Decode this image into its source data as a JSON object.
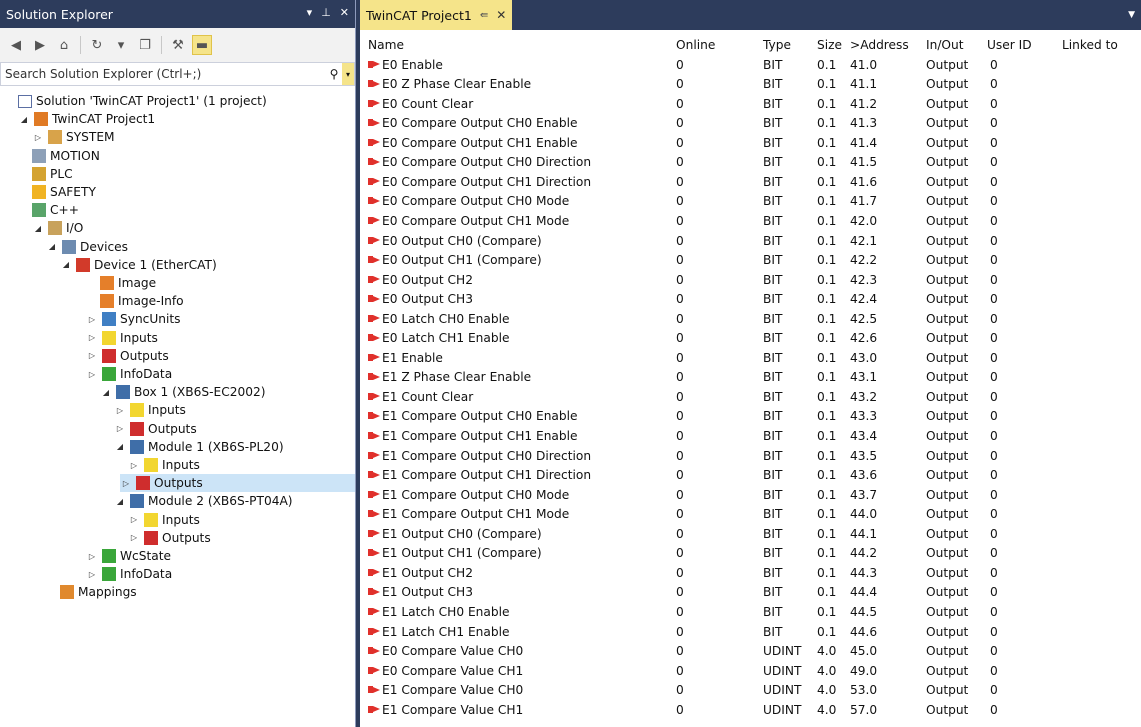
{
  "solution_explorer": {
    "title": "Solution Explorer",
    "title_buttons": [
      "▾",
      "⊥",
      "✕"
    ],
    "search_placeholder": "Search Solution Explorer (Ctrl+;)",
    "tree": [
      {
        "label": "Solution 'TwinCAT Project1' (1 project)",
        "icon": "solution-icon",
        "expand": ""
      },
      {
        "label": "TwinCAT Project1",
        "icon": "twincat-project-icon",
        "expand": "◢"
      },
      {
        "label": "SYSTEM",
        "icon": "system-icon",
        "expand": "▷"
      },
      {
        "label": "MOTION",
        "icon": "motion-icon",
        "expand": ""
      },
      {
        "label": "PLC",
        "icon": "plc-icon",
        "expand": ""
      },
      {
        "label": "SAFETY",
        "icon": "safety-icon",
        "expand": ""
      },
      {
        "label": "C++",
        "icon": "cpp-icon",
        "expand": ""
      },
      {
        "label": "I/O",
        "icon": "io-icon",
        "expand": "◢"
      },
      {
        "label": "Devices",
        "icon": "devices-icon",
        "expand": "◢"
      },
      {
        "label": "Device 1 (EtherCAT)",
        "icon": "ethercat-device-icon",
        "expand": "◢"
      },
      {
        "label": "Image",
        "icon": "image-icon",
        "expand": ""
      },
      {
        "label": "Image-Info",
        "icon": "image-info-icon",
        "expand": ""
      },
      {
        "label": "SyncUnits",
        "icon": "syncunits-icon",
        "expand": "▷"
      },
      {
        "label": "Inputs",
        "icon": "inputs-icon",
        "expand": "▷"
      },
      {
        "label": "Outputs",
        "icon": "outputs-icon",
        "expand": "▷"
      },
      {
        "label": "InfoData",
        "icon": "infodata-icon",
        "expand": "▷"
      },
      {
        "label": "Box 1 (XB6S-EC2002)",
        "icon": "box-icon",
        "expand": "◢"
      },
      {
        "label": "Inputs",
        "icon": "inputs-icon",
        "expand": "▷"
      },
      {
        "label": "Outputs",
        "icon": "outputs-icon",
        "expand": "▷"
      },
      {
        "label": "Module 1 (XB6S-PL20)",
        "icon": "module-icon",
        "expand": "◢"
      },
      {
        "label": "Inputs",
        "icon": "inputs-icon",
        "expand": "▷"
      },
      {
        "label": "Outputs",
        "icon": "outputs-icon",
        "expand": "▷"
      },
      {
        "label": "Module 2 (XB6S-PT04A)",
        "icon": "module-icon",
        "expand": "◢"
      },
      {
        "label": "Inputs",
        "icon": "inputs-icon",
        "expand": "▷"
      },
      {
        "label": "Outputs",
        "icon": "outputs-icon",
        "expand": "▷"
      },
      {
        "label": "WcState",
        "icon": "wcstate-icon",
        "expand": "▷"
      },
      {
        "label": "InfoData",
        "icon": "infodata-icon",
        "expand": "▷"
      },
      {
        "label": "Mappings",
        "icon": "mappings-icon",
        "expand": ""
      }
    ],
    "selected_index": 21
  },
  "project_panel": {
    "tab_title": "TwinCAT Project1",
    "tab_pin": "⇚",
    "tab_close": "✕",
    "columns": [
      "Name",
      "Online",
      "Type",
      "Size",
      ">Address",
      "In/Out",
      "User ID",
      "Linked to"
    ],
    "rows": [
      [
        "E0 Enable",
        "0",
        "BIT",
        "0.1",
        "41.0",
        "Output",
        "0",
        ""
      ],
      [
        "E0 Z Phase Clear Enable",
        "0",
        "BIT",
        "0.1",
        "41.1",
        "Output",
        "0",
        ""
      ],
      [
        "E0 Count Clear",
        "0",
        "BIT",
        "0.1",
        "41.2",
        "Output",
        "0",
        ""
      ],
      [
        "E0 Compare Output CH0 Enable",
        "0",
        "BIT",
        "0.1",
        "41.3",
        "Output",
        "0",
        ""
      ],
      [
        "E0 Compare Output CH1 Enable",
        "0",
        "BIT",
        "0.1",
        "41.4",
        "Output",
        "0",
        ""
      ],
      [
        "E0 Compare Output CH0 Direction",
        "0",
        "BIT",
        "0.1",
        "41.5",
        "Output",
        "0",
        ""
      ],
      [
        "E0 Compare Output CH1 Direction",
        "0",
        "BIT",
        "0.1",
        "41.6",
        "Output",
        "0",
        ""
      ],
      [
        "E0 Compare Output CH0 Mode",
        "0",
        "BIT",
        "0.1",
        "41.7",
        "Output",
        "0",
        ""
      ],
      [
        "E0 Compare Output CH1 Mode",
        "0",
        "BIT",
        "0.1",
        "42.0",
        "Output",
        "0",
        ""
      ],
      [
        "E0 Output CH0 (Compare)",
        "0",
        "BIT",
        "0.1",
        "42.1",
        "Output",
        "0",
        ""
      ],
      [
        "E0 Output CH1 (Compare)",
        "0",
        "BIT",
        "0.1",
        "42.2",
        "Output",
        "0",
        ""
      ],
      [
        "E0 Output CH2",
        "0",
        "BIT",
        "0.1",
        "42.3",
        "Output",
        "0",
        ""
      ],
      [
        "E0 Output CH3",
        "0",
        "BIT",
        "0.1",
        "42.4",
        "Output",
        "0",
        ""
      ],
      [
        "E0 Latch CH0 Enable",
        "0",
        "BIT",
        "0.1",
        "42.5",
        "Output",
        "0",
        ""
      ],
      [
        "E0 Latch CH1 Enable",
        "0",
        "BIT",
        "0.1",
        "42.6",
        "Output",
        "0",
        ""
      ],
      [
        "E1 Enable",
        "0",
        "BIT",
        "0.1",
        "43.0",
        "Output",
        "0",
        ""
      ],
      [
        "E1 Z Phase Clear Enable",
        "0",
        "BIT",
        "0.1",
        "43.1",
        "Output",
        "0",
        ""
      ],
      [
        "E1 Count Clear",
        "0",
        "BIT",
        "0.1",
        "43.2",
        "Output",
        "0",
        ""
      ],
      [
        "E1 Compare Output CH0 Enable",
        "0",
        "BIT",
        "0.1",
        "43.3",
        "Output",
        "0",
        ""
      ],
      [
        "E1 Compare Output CH1 Enable",
        "0",
        "BIT",
        "0.1",
        "43.4",
        "Output",
        "0",
        ""
      ],
      [
        "E1 Compare Output CH0 Direction",
        "0",
        "BIT",
        "0.1",
        "43.5",
        "Output",
        "0",
        ""
      ],
      [
        "E1 Compare Output CH1 Direction",
        "0",
        "BIT",
        "0.1",
        "43.6",
        "Output",
        "0",
        ""
      ],
      [
        "E1 Compare Output CH0 Mode",
        "0",
        "BIT",
        "0.1",
        "43.7",
        "Output",
        "0",
        ""
      ],
      [
        "E1 Compare Output CH1 Mode",
        "0",
        "BIT",
        "0.1",
        "44.0",
        "Output",
        "0",
        ""
      ],
      [
        "E1 Output CH0 (Compare)",
        "0",
        "BIT",
        "0.1",
        "44.1",
        "Output",
        "0",
        ""
      ],
      [
        "E1 Output CH1 (Compare)",
        "0",
        "BIT",
        "0.1",
        "44.2",
        "Output",
        "0",
        ""
      ],
      [
        "E1 Output CH2",
        "0",
        "BIT",
        "0.1",
        "44.3",
        "Output",
        "0",
        ""
      ],
      [
        "E1 Output CH3",
        "0",
        "BIT",
        "0.1",
        "44.4",
        "Output",
        "0",
        ""
      ],
      [
        "E1 Latch CH0 Enable",
        "0",
        "BIT",
        "0.1",
        "44.5",
        "Output",
        "0",
        ""
      ],
      [
        "E1 Latch CH1 Enable",
        "0",
        "BIT",
        "0.1",
        "44.6",
        "Output",
        "0",
        ""
      ],
      [
        "E0 Compare Value CH0",
        "0",
        "UDINT",
        "4.0",
        "45.0",
        "Output",
        "0",
        ""
      ],
      [
        "E0 Compare Value CH1",
        "0",
        "UDINT",
        "4.0",
        "49.0",
        "Output",
        "0",
        ""
      ],
      [
        "E1 Compare Value CH0",
        "0",
        "UDINT",
        "4.0",
        "53.0",
        "Output",
        "0",
        ""
      ],
      [
        "E1 Compare Value CH1",
        "0",
        "UDINT",
        "4.0",
        "57.0",
        "Output",
        "0",
        ""
      ]
    ]
  },
  "colors": {
    "chrome": "#2d3c5c",
    "tab_active": "#f5e48a",
    "selection": "#cce4f7",
    "output_arrow": "#e0302b"
  }
}
